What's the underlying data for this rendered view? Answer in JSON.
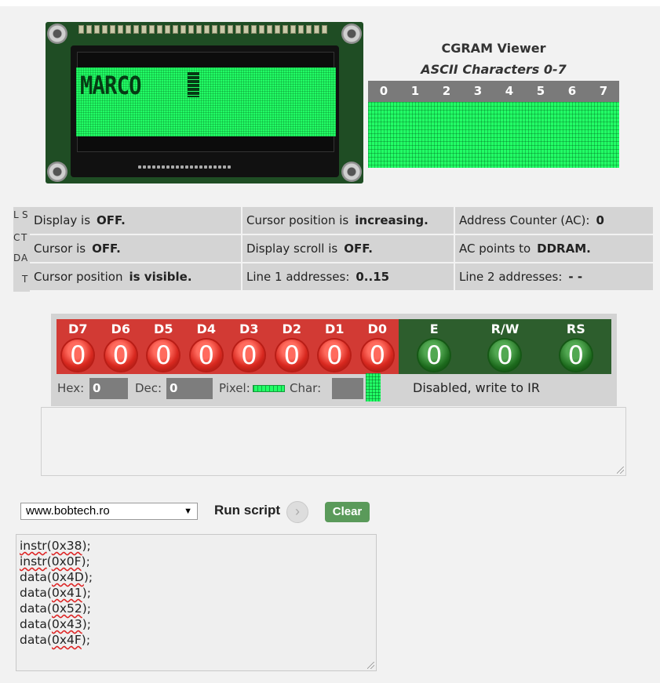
{
  "lcd": {
    "line1_text": "MARCO",
    "line2_text": ""
  },
  "cgram": {
    "title": "CGRAM Viewer",
    "subtitle": "ASCII Characters 0-7",
    "columns": [
      "0",
      "1",
      "2",
      "3",
      "4",
      "5",
      "6",
      "7"
    ]
  },
  "status": {
    "side_letters": [
      "L",
      "S",
      "C",
      "T",
      "D",
      "A",
      "T"
    ],
    "rows": [
      [
        {
          "label": "Display is",
          "value": "OFF."
        },
        {
          "label": "Cursor position is",
          "value": "increasing."
        },
        {
          "label": "Address Counter (AC):",
          "value": "0"
        }
      ],
      [
        {
          "label": "Cursor is",
          "value": "OFF."
        },
        {
          "label": "Display scroll is",
          "value": "OFF."
        },
        {
          "label": "AC points to",
          "value": "DDRAM."
        }
      ],
      [
        {
          "label": "Cursor position",
          "value": "is visible."
        },
        {
          "label": "Line 1 addresses:",
          "value": "0..15"
        },
        {
          "label": "Line 2 addresses:",
          "value": "- -"
        }
      ]
    ]
  },
  "bus": {
    "data_bits": [
      {
        "name": "D7",
        "value": "0"
      },
      {
        "name": "D6",
        "value": "0"
      },
      {
        "name": "D5",
        "value": "0"
      },
      {
        "name": "D4",
        "value": "0"
      },
      {
        "name": "D3",
        "value": "0"
      },
      {
        "name": "D2",
        "value": "0"
      },
      {
        "name": "D1",
        "value": "0"
      },
      {
        "name": "D0",
        "value": "0"
      }
    ],
    "control_bits": [
      {
        "name": "E",
        "value": "0"
      },
      {
        "name": "R/W",
        "value": "0"
      },
      {
        "name": "RS",
        "value": "0"
      }
    ],
    "hex_label": "Hex:",
    "hex_value": "0",
    "dec_label": "Dec:",
    "dec_value": "0",
    "pixel_label": "Pixel:",
    "char_label": "Char:",
    "char_value": "",
    "rs_status": "Disabled, write to IR",
    "data_color": "#d23a34",
    "control_color": "#2d5e2d",
    "lcd_green": "#22ff66"
  },
  "log": {
    "text": ""
  },
  "script": {
    "site_selected": "www.bobtech.ro",
    "run_label": "Run script",
    "clear_label": "Clear",
    "lines": [
      {
        "fn": "instr",
        "arg": "0x38",
        "end": ");"
      },
      {
        "fn": "instr",
        "arg": "0x0F",
        "end": ");"
      },
      {
        "fn": "data",
        "arg": "0x4D",
        "end": ");"
      },
      {
        "fn": "data",
        "arg": "0x41",
        "end": ");"
      },
      {
        "fn": "data",
        "arg": "0x52",
        "end": ");"
      },
      {
        "fn": "data",
        "arg": "0x43",
        "end": ");"
      },
      {
        "fn": "data",
        "arg": "0x4F",
        "end": ");"
      }
    ]
  }
}
